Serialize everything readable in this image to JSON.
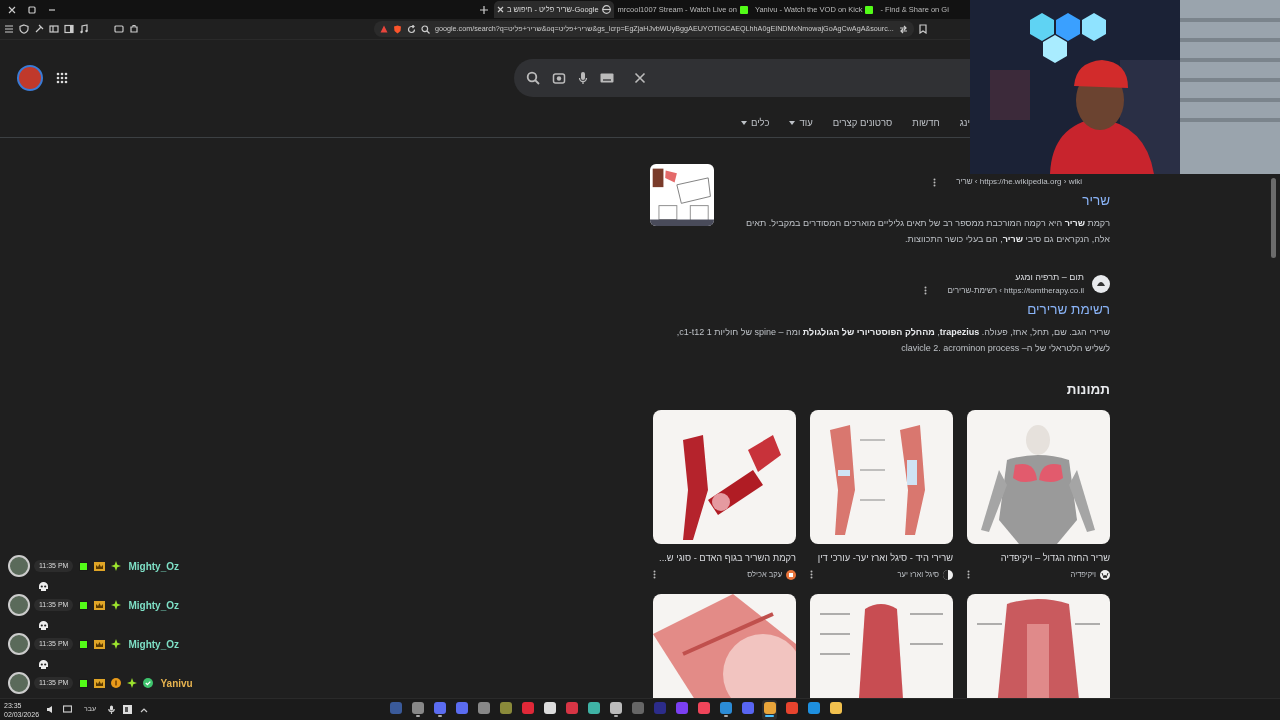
{
  "browser": {
    "tabs": [
      {
        "title": "- Find & Share on Gi",
        "selected": false
      },
      {
        "title": "Yanivu - Watch the VOD on Kick",
        "kind": "kick",
        "selected": false
      },
      {
        "title": "mrcool1007 Stream - Watch Live on",
        "kind": "kick",
        "selected": false
      },
      {
        "title": "שריר פליט - חיפוש ב-Google",
        "kind": "google",
        "selected": true
      }
    ],
    "url": "google.com/search?q=שריר+פליט&oq=שריר+פליט&gs_lcrp=EgZjaHJvbWUyBggAEUYOTIGCAEQLhhA0gEINDMxNmowajGoAgCwAgA&sourc..."
  },
  "nav": [
    {
      "label": "ינג",
      "dropdown": false
    },
    {
      "label": "חדשות",
      "dropdown": false
    },
    {
      "label": "סרטונים קצרים",
      "dropdown": false
    },
    {
      "label": "עוד",
      "dropdown": true
    },
    {
      "label": "כלים",
      "dropdown": true
    }
  ],
  "results": [
    {
      "url": "https://he.wikipedia.org › wiki › שריר",
      "title": "שריר",
      "snippet": "רקמת **שריר** היא רקמה המורכבת ממספר רב של תאים גליליים מוארכים המסודרים במקביל. תאים אלה, הנקראים גם סיבי **שריר**, הם בעלי כושר התכווצות.",
      "thumbnail": true
    },
    {
      "site": "תום – תרפיה ומגע",
      "url": "https://tomtherapy.co.il › רשימת-שרירים",
      "title": "רשימת שרירים",
      "snippet": "שרירי הגב. שם, תחל, אחז, פעולה. **trapezius**, **מהחלק הפוסטריורי של הגולגולת** ומה – spine של חוליות 1 c1-t12, לשליש הלטראלי של ה– clavicle 2. acrominon process",
      "thumbnail": false
    }
  ],
  "images": {
    "heading": "תמונות",
    "items": [
      {
        "caption": "שריר החזה הגדול – ויקיפדיה",
        "source": {
          "name": "ויקיפדיה",
          "kind": "wiki"
        }
      },
      {
        "caption": "שרירי היד - סיגל וארז יער- עורכי דין",
        "source": {
          "name": "סיגל וארז יער",
          "kind": "circle"
        }
      },
      {
        "caption": "רקמת השריר בגוף האדם - סוגי ש...",
        "source": {
          "name": "עקב אכילס",
          "kind": "orange"
        }
      },
      {
        "kind": "picture"
      },
      {
        "kind": "picture"
      },
      {
        "kind": "picture"
      }
    ]
  },
  "chat": [
    {
      "time": "11:35 PM",
      "badges": [
        {
          "kind": "kick"
        },
        {
          "kind": "crown"
        },
        {
          "kind": "sparkle"
        }
      ],
      "name": "Mighty_Oz",
      "color": "#7ee0c6",
      "content": {
        "kind": "emote"
      }
    },
    {
      "time": "11:35 PM",
      "badges": [
        {
          "kind": "kick"
        },
        {
          "kind": "crown"
        },
        {
          "kind": "sparkle"
        }
      ],
      "name": "Mighty_Oz",
      "color": "#7ee0c6",
      "content": {
        "kind": "emote"
      }
    },
    {
      "time": "11:35 PM",
      "badges": [
        {
          "kind": "kick"
        },
        {
          "kind": "crown"
        },
        {
          "kind": "sparkle"
        }
      ],
      "name": "Mighty_Oz",
      "color": "#7ee0c6",
      "content": {
        "kind": "emote"
      }
    },
    {
      "time": "11:35 PM",
      "badges": [
        {
          "kind": "kick"
        },
        {
          "kind": "crown"
        },
        {
          "kind": "coin"
        },
        {
          "kind": "sparkle"
        },
        {
          "kind": "verified"
        }
      ],
      "name": "Yanivu",
      "color": "#e8b450"
    }
  ],
  "taskbar": {
    "time": "23:35",
    "date": "02/03/2026",
    "language": "עבר",
    "apps": [
      {
        "open": false,
        "selected": false
      },
      {
        "open": true,
        "selected": false
      },
      {
        "open": true,
        "selected": false
      },
      {
        "open": false,
        "selected": false
      },
      {
        "open": false,
        "selected": false
      },
      {
        "open": false,
        "selected": false
      },
      {
        "open": false,
        "selected": false
      },
      {
        "open": false,
        "selected": false
      },
      {
        "open": false,
        "selected": false
      },
      {
        "open": false,
        "selected": false
      },
      {
        "open": true,
        "selected": false
      },
      {
        "open": false,
        "selected": false
      },
      {
        "open": false,
        "selected": false
      },
      {
        "open": false,
        "selected": false
      },
      {
        "open": false,
        "selected": false
      },
      {
        "open": true,
        "selected": false
      },
      {
        "open": false,
        "selected": false
      },
      {
        "open": true,
        "selected": true
      },
      {
        "open": false,
        "selected": false
      },
      {
        "open": false,
        "selected": false
      },
      {
        "open": false,
        "selected": false
      }
    ]
  }
}
